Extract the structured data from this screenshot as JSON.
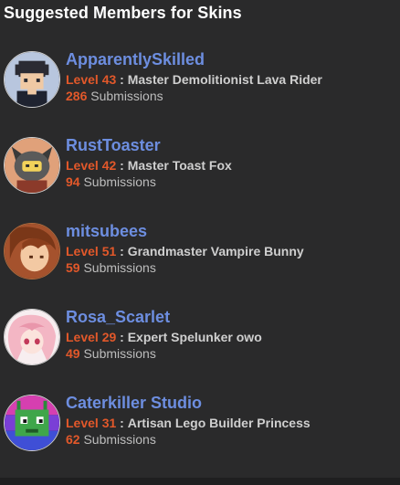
{
  "section": {
    "title": "Suggested Members for Skins"
  },
  "members": [
    {
      "name": "ApparentlySkilled",
      "level_label": "Level 43",
      "separator": ":",
      "rank": "Master Demolitionist Lava Rider",
      "submissions_count": "286",
      "submissions_label": "Submissions"
    },
    {
      "name": "RustToaster",
      "level_label": "Level 42",
      "separator": ":",
      "rank": "Master Toast Fox",
      "submissions_count": "94",
      "submissions_label": "Submissions"
    },
    {
      "name": "mitsubees",
      "level_label": "Level 51",
      "separator": ":",
      "rank": "Grandmaster Vampire Bunny",
      "submissions_count": "59",
      "submissions_label": "Submissions"
    },
    {
      "name": "Rosa_Scarlet",
      "level_label": "Level 29",
      "separator": ":",
      "rank": "Expert Spelunker owo",
      "submissions_count": "49",
      "submissions_label": "Submissions"
    },
    {
      "name": "Caterkiller Studio",
      "level_label": "Level 31",
      "separator": ":",
      "rank": "Artisan Lego Builder Princess",
      "submissions_count": "62",
      "submissions_label": "Submissions"
    }
  ],
  "colors": {
    "background": "#2a2a2b",
    "username": "#6d8ee0",
    "level": "#e2582a",
    "text": "#cfcfcf"
  },
  "icons": [
    "pixel-boy-avatar-icon",
    "robot-fox-avatar-icon",
    "anime-girl-avatar-icon",
    "pink-hair-girl-avatar-icon",
    "pixel-cat-avatar-icon"
  ]
}
